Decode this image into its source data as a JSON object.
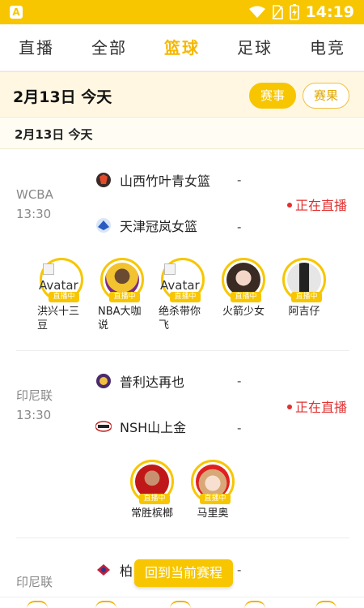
{
  "status_bar": {
    "time": "14:19",
    "app_badge": "A"
  },
  "tabs": [
    {
      "label": "直播",
      "active": false
    },
    {
      "label": "全部",
      "active": false
    },
    {
      "label": "篮球",
      "active": true
    },
    {
      "label": "足球",
      "active": false
    },
    {
      "label": "电竞",
      "active": false
    }
  ],
  "date_header": {
    "title": "2月13日 今天",
    "schedule_label": "赛事",
    "results_label": "赛果"
  },
  "sub_date": "2月13日  今天",
  "matches": [
    {
      "league": "WCBA",
      "time": "13:30",
      "home": {
        "name": "山西竹叶青女篮",
        "score": "-"
      },
      "away": {
        "name": "天津冠岚女篮",
        "score": "-"
      },
      "status": "正在直播",
      "anchors": [
        {
          "name": "洪兴十三豆",
          "alt": "Avatar",
          "live_tag": "直播中"
        },
        {
          "name": "NBA大咖说",
          "alt": "",
          "live_tag": "直播中"
        },
        {
          "name": "绝杀带你飞",
          "alt": "Avatar",
          "live_tag": "直播中"
        },
        {
          "name": "火箭少女",
          "alt": "",
          "live_tag": "直播中"
        },
        {
          "name": "阿吉仔",
          "alt": "",
          "live_tag": "直播中"
        }
      ]
    },
    {
      "league": "印尼联",
      "time": "13:30",
      "home": {
        "name": "普利达再也",
        "score": "-"
      },
      "away": {
        "name": "NSH山上金",
        "score": "-"
      },
      "status": "正在直播",
      "anchors": [
        {
          "name": "常胜槟榔",
          "alt": "",
          "live_tag": "直播中"
        },
        {
          "name": "马里奥",
          "alt": "",
          "live_tag": "直播中"
        }
      ]
    },
    {
      "league": "印尼联",
      "home": {
        "name": "柏",
        "score": "-"
      }
    }
  ],
  "float_button": "回到当前赛程",
  "colors": {
    "accent": "#f7c600",
    "live": "#e03030",
    "date_bg": "#fff7e2"
  }
}
